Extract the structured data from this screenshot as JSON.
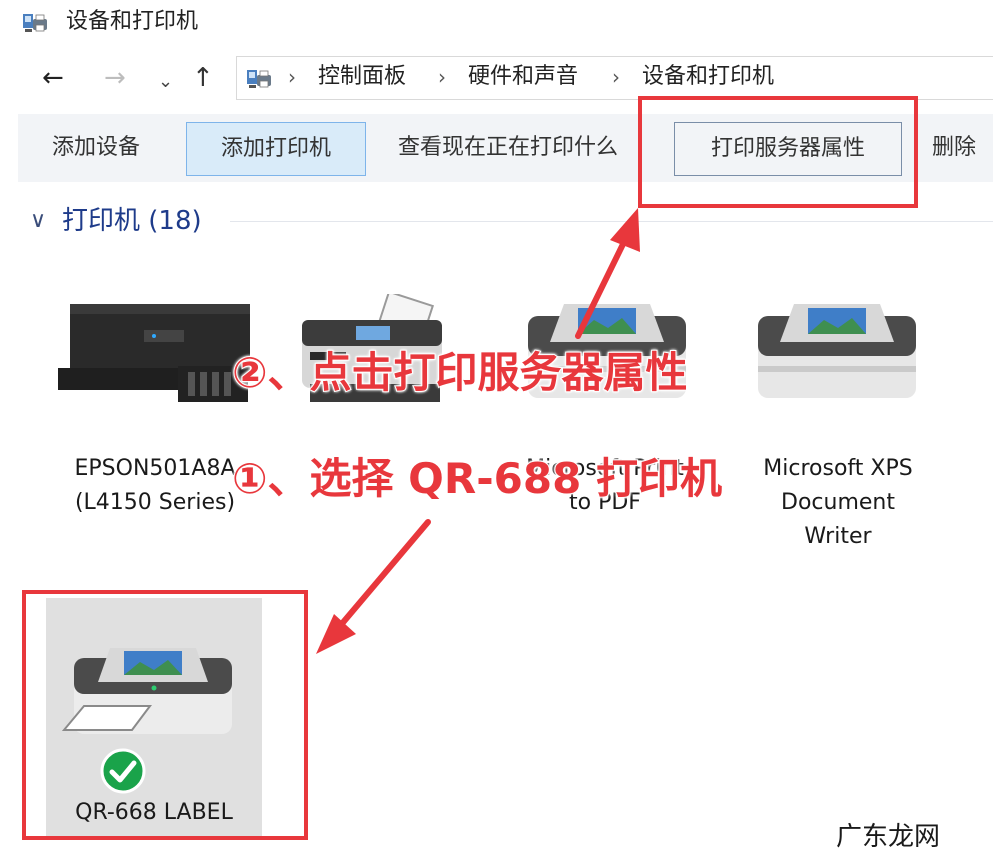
{
  "window": {
    "title": "设备和打印机"
  },
  "nav": {
    "back_icon": "←",
    "forward_icon": "→",
    "recent_icon": "⌄",
    "up_icon": "↑",
    "separator": "›",
    "breadcrumbs": [
      "控制面板",
      "硬件和声音",
      "设备和打印机"
    ]
  },
  "toolbar": {
    "add_device": "添加设备",
    "add_printer": "添加打印机",
    "see_printing": "查看现在正在打印什么",
    "print_server_properties": "打印服务器属性",
    "delete": "删除"
  },
  "group": {
    "chevron": "∨",
    "label": "打印机 (18)"
  },
  "devices": [
    {
      "line1": "EPSON501A8A",
      "line2": "(L4150 Series)",
      "icon": "epson-printer-icon"
    },
    {
      "line1": "Fax",
      "line2": "",
      "icon": "fax-icon"
    },
    {
      "line1": "Microsoft Print",
      "line2": "to PDF",
      "icon": "printer-icon"
    },
    {
      "line1": "Microsoft XPS",
      "line2": "Document",
      "line3": "Writer",
      "icon": "printer-icon"
    }
  ],
  "selected_device": {
    "label": "QR-668 LABEL",
    "icon": "printer-icon",
    "status_icon": "default-check-icon"
  },
  "annotations": {
    "step2": "②、点击打印服务器属性",
    "step1": "①、选择 QR-688 打印机"
  },
  "watermark": "广东龙网",
  "colors": {
    "highlight_red": "#e8373c",
    "group_blue": "#1e3b8a",
    "check_green": "#1aa34a"
  }
}
